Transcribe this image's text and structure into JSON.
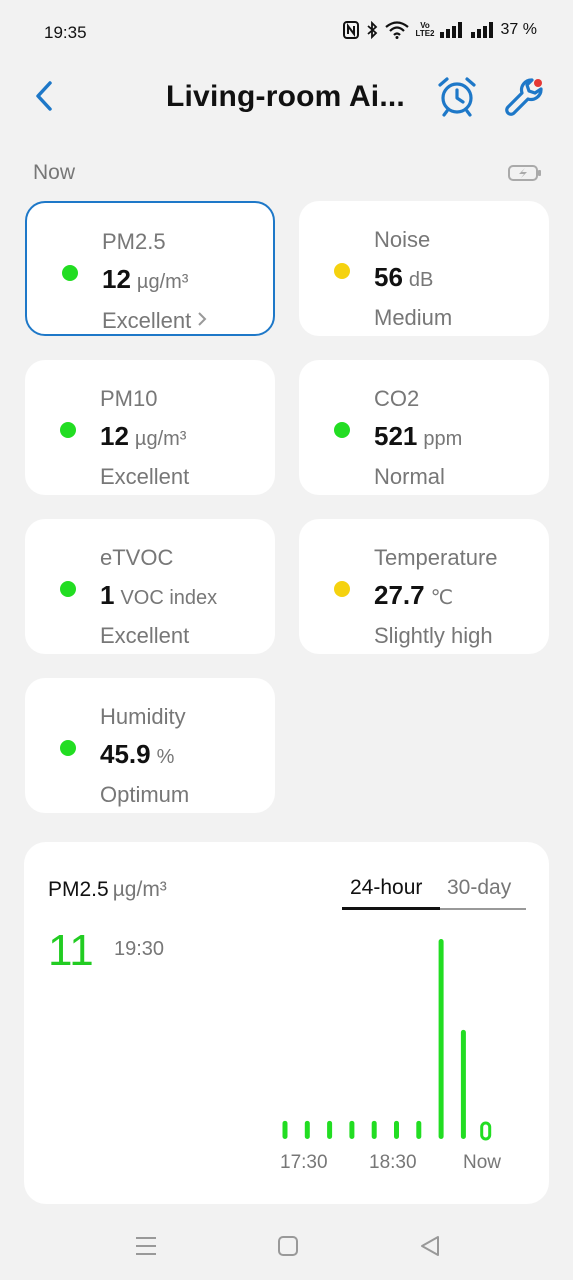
{
  "status_bar": {
    "time": "19:35",
    "volte_top": "Vo",
    "volte_bottom": "LTE2",
    "battery": "37 %",
    "icons": [
      "nfc-icon",
      "bluetooth-icon",
      "wifi-icon",
      "volte-icon",
      "signal-icon",
      "signal-icon"
    ]
  },
  "header": {
    "title": "Living-room Ai...",
    "back_icon": "chevron-left-icon",
    "alarm_icon": "alarm-clock-icon",
    "tools_icon": "wrench-icon"
  },
  "now_label": "Now",
  "colors": {
    "accent": "#1e78c8",
    "good": "#22dd22",
    "warn": "#f5d20f"
  },
  "metrics": [
    {
      "name": "PM2.5",
      "value": "12",
      "unit": "µg/m³",
      "status": "Excellent",
      "level": "good"
    },
    {
      "name": "Noise",
      "value": "56",
      "unit": "dB",
      "status": "Medium",
      "level": "warn"
    },
    {
      "name": "PM10",
      "value": "12",
      "unit": "µg/m³",
      "status": "Excellent",
      "level": "good"
    },
    {
      "name": "CO2",
      "value": "521",
      "unit": "ppm",
      "status": "Normal",
      "level": "good"
    },
    {
      "name": "eTVOC",
      "value": "1",
      "unit": "VOC index",
      "status": "Excellent",
      "level": "good"
    },
    {
      "name": "Temperature",
      "value": "27.7",
      "unit": "℃",
      "status": "Slightly high",
      "level": "warn"
    },
    {
      "name": "Humidity",
      "value": "45.9",
      "unit": "%",
      "status": "Optimum",
      "level": "good"
    }
  ],
  "chart_card": {
    "title": "PM2.5",
    "unit": "µg/m³",
    "tabs": [
      "24-hour",
      "30-day"
    ],
    "active_tab": "24-hour",
    "current_value": "11",
    "current_time": "19:30"
  },
  "chart_data": {
    "type": "bar",
    "title": "PM2.5",
    "xlabel": "",
    "ylabel": "",
    "x_tick_labels": [
      "17:30",
      "18:30",
      "Now"
    ],
    "values": [
      1,
      1,
      1,
      1,
      1,
      1,
      1,
      11,
      6,
      1
    ],
    "highlight_last": true,
    "grid": false
  },
  "nav": {
    "menu_icon": "menu-icon",
    "home_icon": "home-square-icon",
    "back_icon": "back-triangle-icon"
  }
}
